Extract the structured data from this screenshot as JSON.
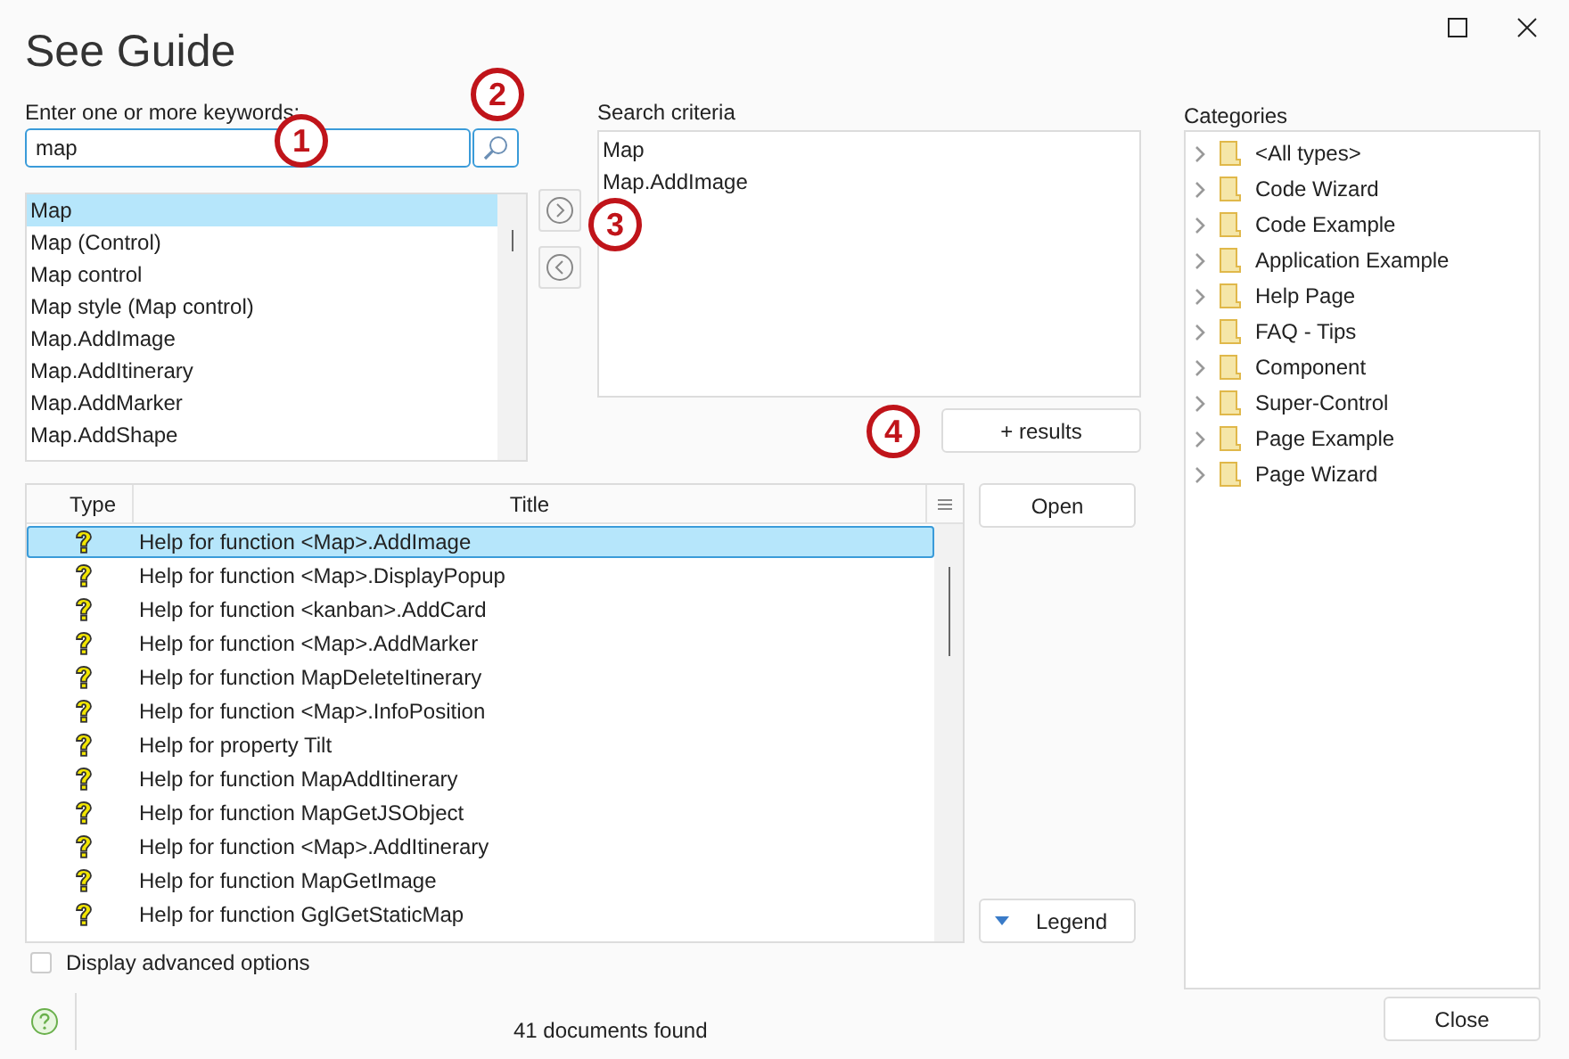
{
  "window": {
    "title": "See Guide"
  },
  "keywords": {
    "label": "Enter one or more keywords:",
    "value": "map"
  },
  "keyword_list": [
    {
      "label": "Map",
      "selected": true
    },
    {
      "label": "Map (Control)",
      "selected": false
    },
    {
      "label": "Map control",
      "selected": false
    },
    {
      "label": "Map style (Map control)",
      "selected": false
    },
    {
      "label": "Map.AddImage",
      "selected": false
    },
    {
      "label": "Map.AddItinerary",
      "selected": false
    },
    {
      "label": "Map.AddMarker",
      "selected": false
    },
    {
      "label": "Map.AddShape",
      "selected": false
    }
  ],
  "criteria": {
    "label": "Search criteria",
    "items": [
      "Map",
      "Map.AddImage"
    ]
  },
  "results_button": "+ results",
  "results": {
    "columns": [
      "Type",
      "Title"
    ],
    "rows": [
      {
        "title": "Help for function <Map>.AddImage",
        "selected": true
      },
      {
        "title": "Help for function <Map>.DisplayPopup",
        "selected": false
      },
      {
        "title": "Help for function <kanban>.AddCard",
        "selected": false
      },
      {
        "title": "Help for function <Map>.AddMarker",
        "selected": false
      },
      {
        "title": "Help for function MapDeleteItinerary",
        "selected": false
      },
      {
        "title": "Help for function <Map>.InfoPosition",
        "selected": false
      },
      {
        "title": "Help for property Tilt",
        "selected": false
      },
      {
        "title": "Help for function MapAddItinerary",
        "selected": false
      },
      {
        "title": "Help for function MapGetJSObject",
        "selected": false
      },
      {
        "title": "Help for function <Map>.AddItinerary",
        "selected": false
      },
      {
        "title": "Help for function MapGetImage",
        "selected": false
      },
      {
        "title": "Help for function GglGetStaticMap",
        "selected": false
      }
    ]
  },
  "open_button": "Open",
  "legend_button": "Legend",
  "advanced_options": {
    "label": "Display advanced options",
    "checked": false
  },
  "status_bar": "41 documents found",
  "categories": {
    "label": "Categories",
    "items": [
      {
        "label": "<All types>",
        "expanded": false
      },
      {
        "label": "Code Wizard",
        "expanded": false
      },
      {
        "label": "Code Example",
        "expanded": false
      },
      {
        "label": "Application Example",
        "expanded": false
      },
      {
        "label": "Help Page",
        "expanded": false
      },
      {
        "label": "FAQ - Tips",
        "expanded": false
      },
      {
        "label": "Component",
        "expanded": false
      },
      {
        "label": "Super-Control",
        "expanded": false
      },
      {
        "label": "Page Example",
        "expanded": false
      },
      {
        "label": "Page Wizard",
        "expanded": false
      }
    ]
  },
  "close_button": "Close",
  "annotations": [
    "1",
    "2",
    "3",
    "4"
  ]
}
